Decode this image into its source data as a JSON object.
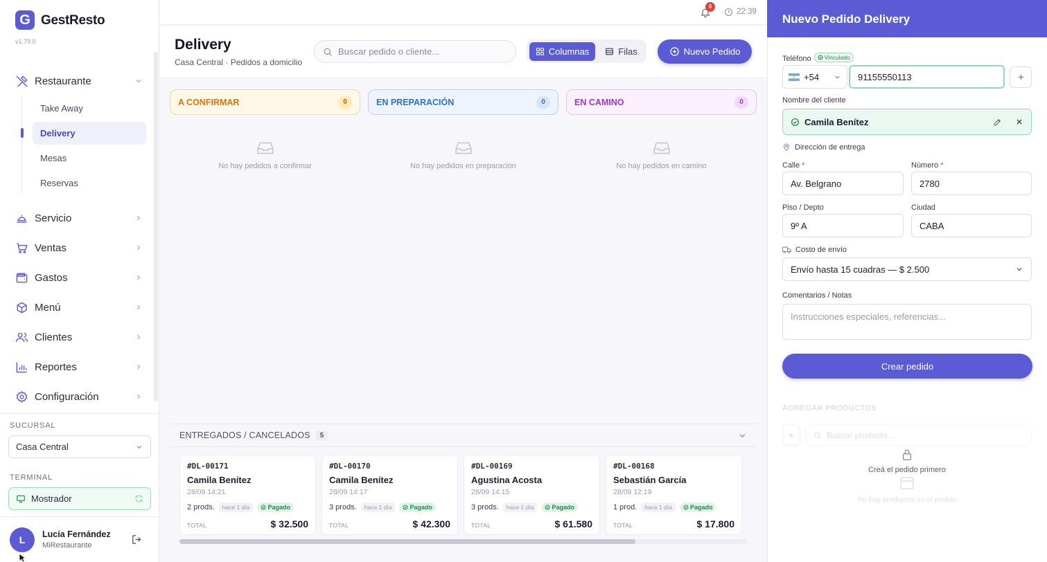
{
  "app": {
    "name": "GestResto",
    "logo_letter": "G",
    "version": "v1.79.0"
  },
  "sidebar": {
    "groups": [
      {
        "label": "Restaurante",
        "icon": "utensils-icon",
        "expanded": true,
        "subitems": [
          {
            "label": "Take Away"
          },
          {
            "label": "Delivery",
            "active": true
          },
          {
            "label": "Mesas"
          },
          {
            "label": "Reservas"
          }
        ]
      },
      {
        "label": "Servicio",
        "icon": "bell-service-icon"
      },
      {
        "label": "Ventas",
        "icon": "cart-icon"
      },
      {
        "label": "Gastos",
        "icon": "wallet-icon"
      },
      {
        "label": "Menú",
        "icon": "box-icon"
      },
      {
        "label": "Clientes",
        "icon": "users-icon"
      },
      {
        "label": "Reportes",
        "icon": "bar-chart-icon"
      },
      {
        "label": "Configuración",
        "icon": "gear-icon"
      }
    ],
    "branch_label": "SUCURSAL",
    "branch_value": "Casa Central",
    "terminal_label": "TERMINAL",
    "terminal_value": "Mostrador",
    "user": {
      "initial": "L",
      "name": "Lucía Fernández",
      "org": "MiRestaurante"
    }
  },
  "topbar": {
    "notifications": "6",
    "time": "22:39"
  },
  "header": {
    "title": "Delivery",
    "subtitle": "Casa Central · Pedidos a domicilio",
    "search_placeholder": "Buscar pedido o cliente...",
    "view_columns": "Columnas",
    "view_rows": "Filas",
    "new_order": "Nuevo Pedido"
  },
  "columns": [
    {
      "title": "A CONFIRMAR",
      "count": "0",
      "empty": "No hay pedidos a confirmar",
      "color": "#d97706",
      "bg": "#fff8e6",
      "border": "#f6d98c"
    },
    {
      "title": "EN PREPARACIÓN",
      "count": "0",
      "empty": "No hay pedidos en preparación",
      "color": "#2f6fd0",
      "bg": "#eef4fd",
      "border": "#b9d2f4"
    },
    {
      "title": "EN CAMINO",
      "count": "0",
      "empty": "No hay pedidos en camino",
      "color": "#a235c9",
      "bg": "#fbf0fd",
      "border": "#e6c3f1"
    }
  ],
  "delivered": {
    "title": "ENTREGADOS / CANCELADOS",
    "count": "5",
    "total_label": "TOTAL",
    "orders": [
      {
        "code": "#DL-00171",
        "customer": "Camila Benítez",
        "date": "28/09 14:21",
        "products": "2 prods.",
        "ago": "hace 1 día",
        "status": "Pagado",
        "total": "$ 32.500"
      },
      {
        "code": "#DL-00170",
        "customer": "Camila Benítez",
        "date": "28/09 14:17",
        "products": "3 prods.",
        "ago": "hace 1 día",
        "status": "Pagado",
        "total": "$ 42.300"
      },
      {
        "code": "#DL-00169",
        "customer": "Agustina Acosta",
        "date": "28/09 14:15",
        "products": "3 prods.",
        "ago": "hace 1 día",
        "status": "Pagado",
        "total": "$ 61.580"
      },
      {
        "code": "#DL-00168",
        "customer": "Sebastián García",
        "date": "28/09 12:19",
        "products": "1 prod.",
        "ago": "hace 1 día",
        "status": "Pagado",
        "total": "$ 17.800"
      }
    ]
  },
  "panel": {
    "title": "Nuevo Pedido Delivery",
    "phone_label": "Teléfono",
    "linked_badge": "Vinculado",
    "country_code": "+54",
    "phone_value": "91155550113",
    "name_label": "Nombre del cliente",
    "client_name": "Camila Benítez",
    "address_label": "Dirección de entrega",
    "street_label": "Calle",
    "street_value": "Av. Belgrano",
    "number_label": "Número",
    "number_value": "2780",
    "floor_label": "Piso / Depto",
    "floor_value": "9º A",
    "city_label": "Ciudad",
    "city_value": "CABA",
    "shipping_label": "Costo de envío",
    "shipping_value": "Envío hasta 15 cuadras — $ 2.500",
    "notes_label": "Comentarios / Notas",
    "notes_placeholder": "Instrucciones especiales, referencias...",
    "create_button": "Crear pedido",
    "products_title": "AGREGAR PRODUCTOS",
    "product_search_placeholder": "Buscar producto...",
    "locked_message": "Creá el pedido primero",
    "no_products": "No hay productos en el pedido"
  },
  "colors": {
    "accent": "#5b5bd6",
    "success": "#1d8a4e",
    "danger": "#e0433d"
  }
}
